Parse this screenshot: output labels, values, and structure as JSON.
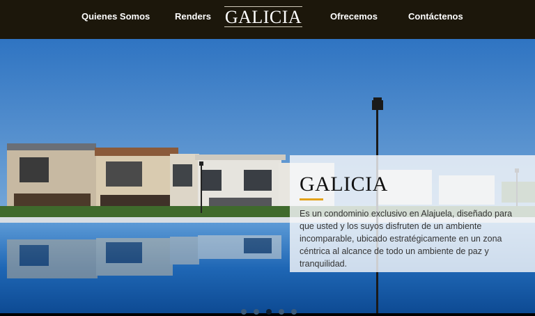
{
  "nav": {
    "links": [
      {
        "label": "Quienes Somos"
      },
      {
        "label": "Renders"
      },
      {
        "label": "Ofrecemos"
      },
      {
        "label": "Contáctenos"
      }
    ],
    "logo": "GALICIA"
  },
  "hero": {
    "image": "condominium-with-pool-photo",
    "title": "GALICIA",
    "description": "Es un condominio exclusivo en Alajuela, diseñado para que usted y los suyos disfruten de un ambiente incomparable, ubicado estratégicamente en un zona céntrica al alcance de todo un ambiente de paz y tranquilidad.",
    "accent_color": "#e3a21a"
  },
  "slider": {
    "slide_count": 5,
    "active_index": 2
  },
  "colors": {
    "navbar": "#1c170b",
    "sky": "#3e7fc5",
    "pool": "#1f67b5"
  }
}
